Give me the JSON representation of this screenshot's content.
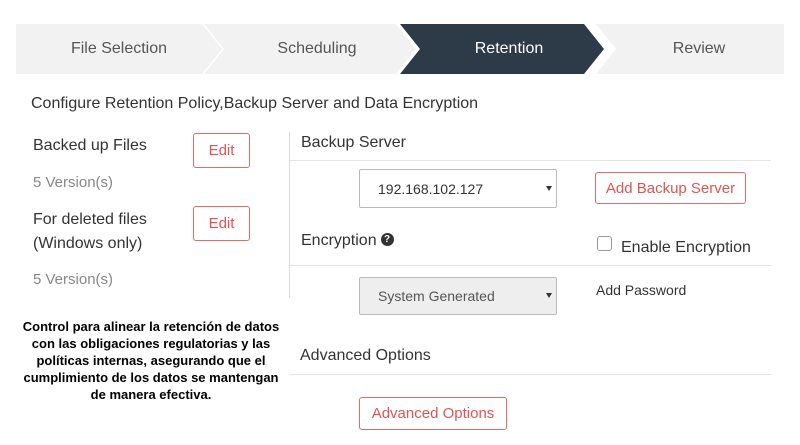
{
  "wizard": {
    "steps": [
      {
        "label": "File Selection",
        "active": false
      },
      {
        "label": "Scheduling",
        "active": false
      },
      {
        "label": "Retention",
        "active": true
      },
      {
        "label": "Review",
        "active": false
      }
    ]
  },
  "heading": "Configure Retention Policy,Backup Server and Data Encryption",
  "left": {
    "backed_up_label": "Backed up Files",
    "backed_up_edit": "Edit",
    "backed_up_versions": "5 Version(s)",
    "deleted_label_line1": "For deleted files",
    "deleted_label_line2": "(Windows only)",
    "deleted_edit": "Edit",
    "deleted_versions": "5 Version(s)"
  },
  "backup_server": {
    "title": "Backup Server",
    "selected": "192.168.102.127",
    "add_button": "Add Backup Server"
  },
  "encryption": {
    "title": "Encryption",
    "enable_label": "Enable Encryption",
    "enabled": false,
    "selected": "System Generated",
    "add_password": "Add Password"
  },
  "advanced": {
    "title": "Advanced Options",
    "button": "Advanced Options"
  },
  "note": "Control para alinear la retención de datos con las obligaciones regulatorias y las políticas internas, asegurando que el cumplimiento de los datos se mantengan de manera efectiva.",
  "colors": {
    "active_step": "#2d3a48",
    "inactive_step": "#f2f2f2",
    "accent_red": "#e25454"
  }
}
